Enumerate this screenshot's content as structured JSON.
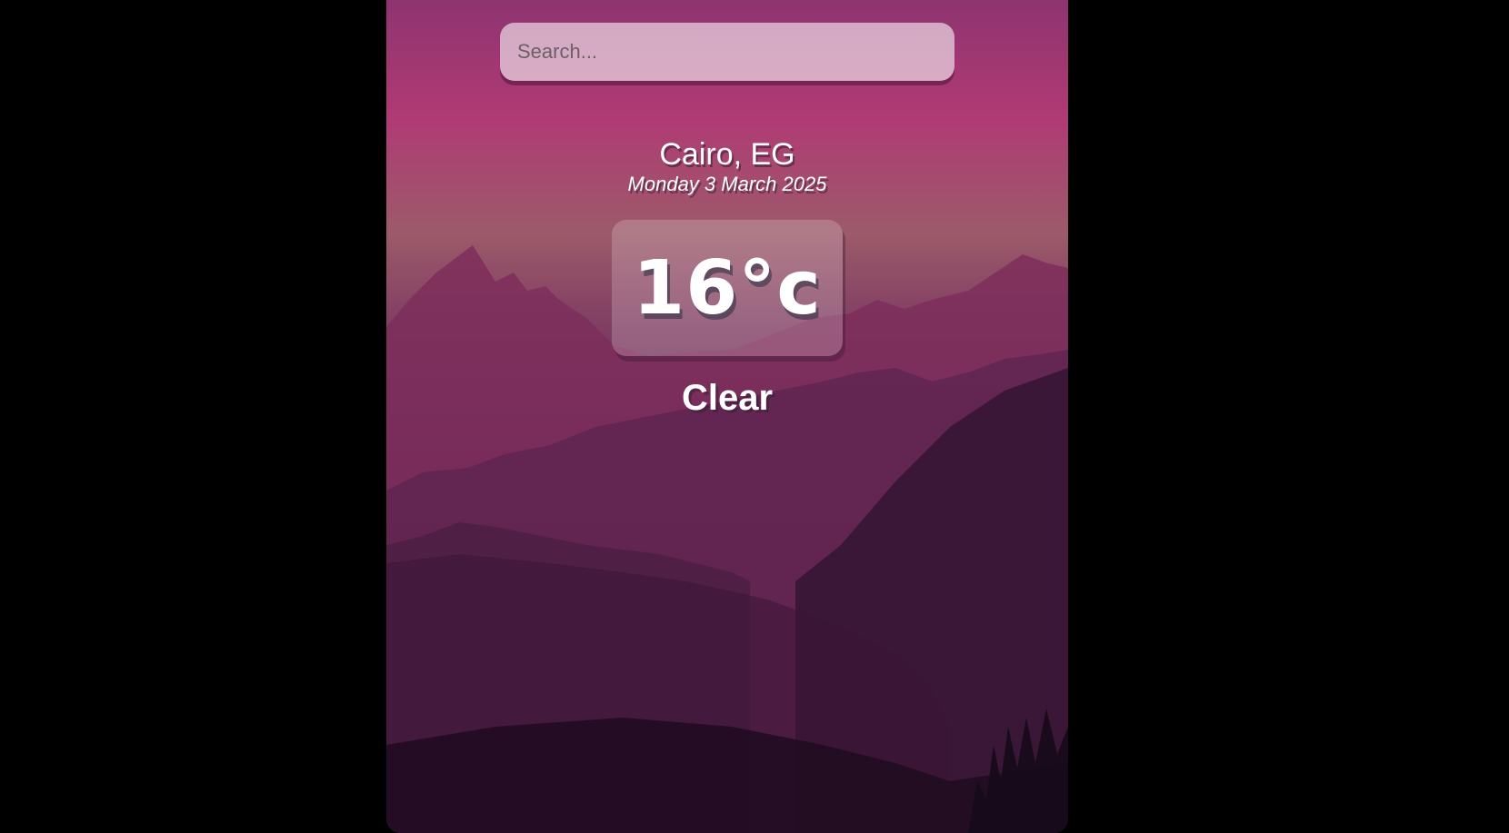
{
  "search": {
    "placeholder": "Search...",
    "value": ""
  },
  "location": {
    "city": "Cairo, EG",
    "date": "Monday 3 March 2025"
  },
  "weather": {
    "temperature": "16°c",
    "condition": "Clear"
  },
  "colors": {
    "page_background": "#000000",
    "sky_top": "#8e3470",
    "sky_pink": "#b03a74",
    "text": "#ffffff"
  }
}
